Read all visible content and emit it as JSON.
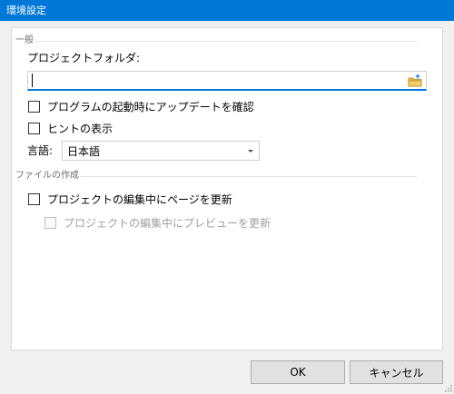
{
  "window": {
    "title": "環境設定"
  },
  "general": {
    "section_label": "一般",
    "project_folder_label": "プロジェクトフォルダ:",
    "project_folder_value": "",
    "project_folder_placeholder": "",
    "folder_icon": "open-folder-icon",
    "check_updates": {
      "label": "プログラムの起動時にアップデートを確認",
      "checked": false
    },
    "show_hints": {
      "label": "ヒントの表示",
      "checked": false
    },
    "language_label": "言語:",
    "language_selected": "日本語"
  },
  "file_creation": {
    "section_label": "ファイルの作成",
    "update_page": {
      "label": "プロジェクトの編集中にページを更新",
      "checked": false
    },
    "update_preview": {
      "label": "プロジェクトの編集中にプレビューを更新",
      "checked": false,
      "disabled": true
    }
  },
  "buttons": {
    "ok": "OK",
    "cancel": "キャンセル"
  },
  "colors": {
    "titlebar": "#0078d7",
    "focus": "#0078d7",
    "disabled_text": "#a0a0a0"
  }
}
